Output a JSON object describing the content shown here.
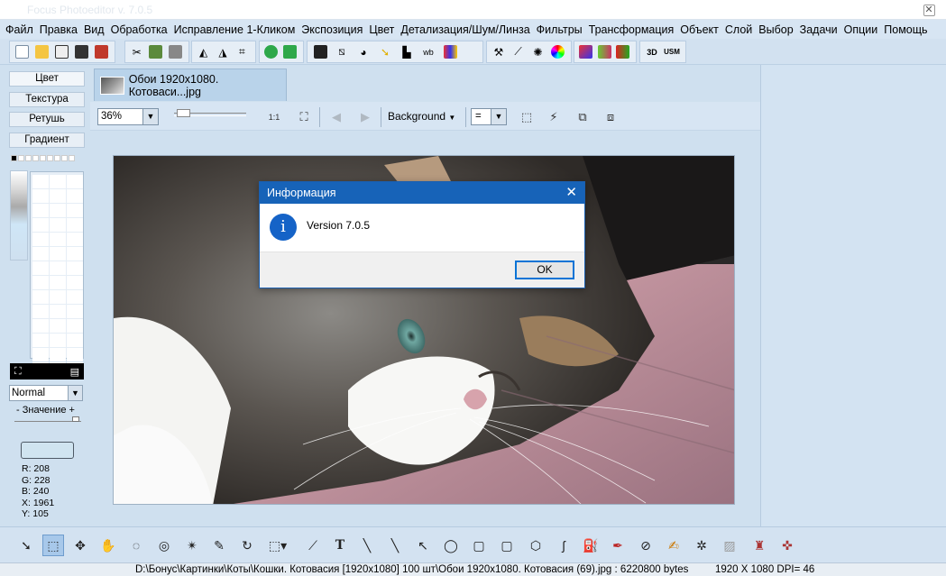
{
  "window": {
    "title": "Focus Photoeditor v. 7.0.5",
    "close_glyph": "✕"
  },
  "menu": [
    "Файл",
    "Правка",
    "Вид",
    "Обработка",
    "Исправление 1-Кликом",
    "Экспозиция",
    "Цвет",
    "Детализация/Шум/Линза",
    "Фильтры",
    "Трансформация",
    "Объект",
    "Слой",
    "Выбор",
    "Задачи",
    "Опции",
    "Помощь"
  ],
  "toolbar_text": {
    "usm": "USM",
    "three_d": "3D"
  },
  "left_panel": {
    "tabs": [
      "Цвет",
      "Текстура",
      "Ретушь",
      "Градиент"
    ],
    "blend_mode": "Normal",
    "value_label": "- Значение +",
    "readout": {
      "r": "R: 208",
      "g": "G: 228",
      "b": "B: 240",
      "x": "X: 1961",
      "y": "Y: 105"
    }
  },
  "document": {
    "tab_label": "Обои 1920x1080. Котоваси...jpg"
  },
  "image_toolbar": {
    "zoom": "36%",
    "background": "Background",
    "eq": "=",
    "zoom_reset_label": "1:1",
    "slider_fraction": 0.05
  },
  "dialog": {
    "title": "Информация",
    "icon_glyph": "i",
    "message": "Version 7.0.5",
    "ok_label": "OK",
    "close_glyph": "✕"
  },
  "status": {
    "path": "D:\\Бонус\\Картинки\\Коты\\Кошки. Котовасия [1920x1080] 100 шт\\Обои 1920x1080. Котовасия  (69).jpg : 6220800 bytes",
    "dims": "1920 X 1080 DPI= 46"
  },
  "colors": {
    "accent": "#1763b8",
    "panel_bg": "#cfe0ef",
    "menu_bg": "#d7e5f3"
  },
  "icons": {
    "toolbar": [
      "new-icon",
      "open-icon",
      "scan-icon",
      "save-as-icon",
      "save-icon",
      "cut-icon",
      "copy-icon",
      "paste-icon",
      "rotate-left-icon",
      "rotate-right-icon",
      "crop-icon",
      "auto-fix-icon",
      "auto-contrast-icon",
      "levels-icon",
      "no-noise-icon",
      "exposure-icon",
      "light-icon",
      "histogram-icon",
      "white-balance-icon",
      "color-bars-icon",
      "hue-icon",
      "brush-icon",
      "curve-icon",
      "sparkle-icon",
      "color-wheel-icon",
      "gradient-icon",
      "palette-icon",
      "channels-icon",
      "three-d-icon",
      "usm-icon"
    ],
    "bottom": [
      "pointer-icon",
      "rect-select-icon",
      "move-icon",
      "hand-icon",
      "lasso-icon",
      "magic-lasso-icon",
      "magic-wand-icon",
      "freehand-select-icon",
      "rotate-select-icon",
      "select-dropdown-icon",
      "eyedropper-icon",
      "text-icon",
      "brush-line-icon",
      "line-icon",
      "arrow-icon",
      "ellipse-icon",
      "rect-icon",
      "rounded-rect-icon",
      "hexagon-icon",
      "curve-icon",
      "fill-icon",
      "pen-icon",
      "no-entry-icon",
      "paint-brush-icon",
      "clone-icon",
      "eraser-icon",
      "stamp-icon",
      "retouch-icon"
    ]
  }
}
